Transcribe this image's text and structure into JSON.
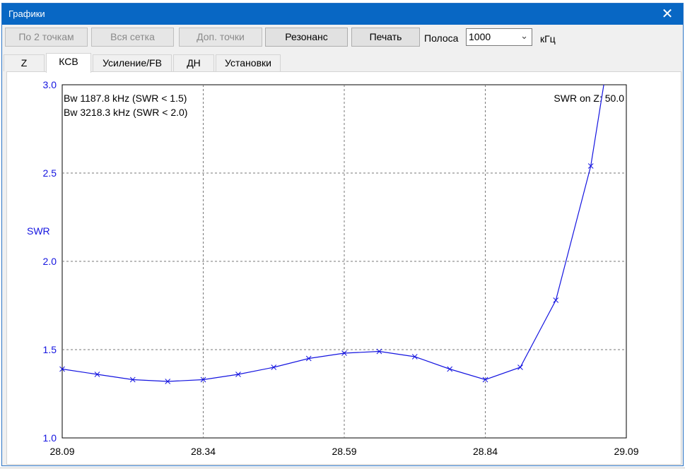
{
  "window": {
    "title": "Графики",
    "close_glyph": "✕"
  },
  "toolbar": {
    "buttons": [
      {
        "label": "По 2 точкам",
        "enabled": false
      },
      {
        "label": "Вся сетка",
        "enabled": false
      },
      {
        "label": "Доп. точки",
        "enabled": false
      },
      {
        "label": "Резонанс",
        "enabled": true
      },
      {
        "label": "Печать",
        "enabled": true
      }
    ],
    "band_label": "Полоса",
    "band_value": "1000",
    "unit_label": "кГц"
  },
  "tabs": [
    {
      "label": "Z",
      "active": false
    },
    {
      "label": "КСВ",
      "active": true
    },
    {
      "label": "Усиление/FB",
      "active": false
    },
    {
      "label": "ДН",
      "active": false
    },
    {
      "label": "Установки",
      "active": false
    }
  ],
  "colors": {
    "accent": "#0867c4",
    "series": "#1414e0",
    "grid": "#777777"
  },
  "chart_data": {
    "type": "line",
    "ylabel": "SWR",
    "xlabel": "",
    "xlim": [
      28.09,
      29.09
    ],
    "ylim": [
      1.0,
      3.0
    ],
    "x_ticks": [
      "28.09",
      "28.34",
      "28.59",
      "28.84",
      "29.09"
    ],
    "y_ticks": [
      "1.0",
      "1.5",
      "2.0",
      "2.5",
      "3.0"
    ],
    "grid": true,
    "annotations": [
      "Bw 1187.8 kHz (SWR < 1.5)",
      "Bw 3218.3 kHz (SWR < 2.0)",
      "SWR on Z: 50.0"
    ],
    "series": [
      {
        "markers": "x",
        "x": [
          28.09,
          28.152,
          28.215,
          28.277,
          28.34,
          28.402,
          28.465,
          28.527,
          28.59,
          28.652,
          28.715,
          28.777,
          28.84,
          28.902,
          28.965,
          29.027,
          29.05
        ],
        "y": [
          1.39,
          1.36,
          1.33,
          1.32,
          1.33,
          1.36,
          1.4,
          1.45,
          1.48,
          1.49,
          1.46,
          1.39,
          1.33,
          1.4,
          1.78,
          2.54,
          3.0
        ]
      }
    ]
  }
}
